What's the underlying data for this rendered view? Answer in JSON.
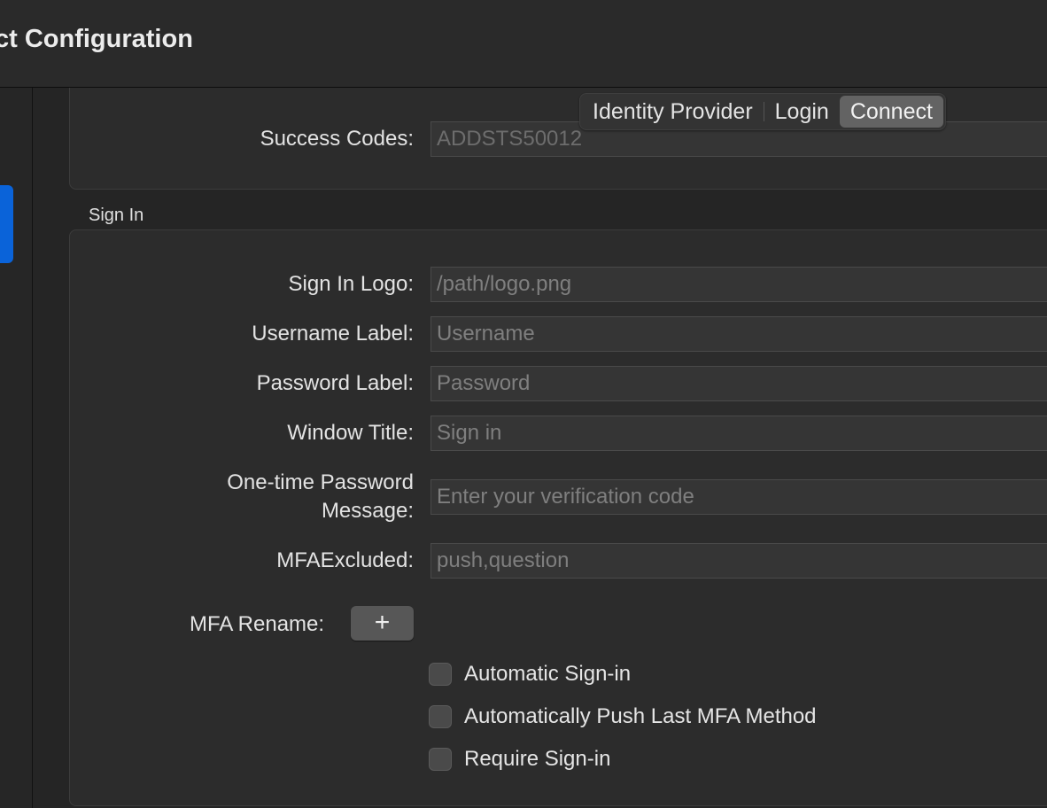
{
  "window": {
    "title": "ct Configuration"
  },
  "tabs": [
    {
      "label": "Identity Provider",
      "active": false
    },
    {
      "label": "Login",
      "active": false
    },
    {
      "label": "Connect",
      "active": true
    }
  ],
  "top_group": {
    "success_codes_label": "Success Codes:",
    "success_codes_value": "ADDSTS50012"
  },
  "sign_in": {
    "section_title": "Sign In",
    "fields": [
      {
        "label": "Sign In Logo:",
        "placeholder": "/path/logo.png"
      },
      {
        "label": "Username Label:",
        "placeholder": "Username"
      },
      {
        "label": "Password Label:",
        "placeholder": "Password"
      },
      {
        "label": "Window Title:",
        "placeholder": "Sign in"
      },
      {
        "label_line1": "One-time Password",
        "label_line2": "Message:",
        "placeholder": "Enter your verification code"
      },
      {
        "label": "MFAExcluded:",
        "placeholder": "push,question"
      }
    ],
    "mfa_rename_label": "MFA Rename:",
    "add_button_symbol": "+",
    "checkboxes": [
      {
        "label": "Automatic Sign-in",
        "checked": false
      },
      {
        "label": "Automatically Push Last MFA Method",
        "checked": false
      },
      {
        "label": "Require Sign-in",
        "checked": false
      }
    ]
  },
  "colors": {
    "accent": "#0a63d9",
    "background": "#252525",
    "group_background": "#2c2c2c"
  }
}
